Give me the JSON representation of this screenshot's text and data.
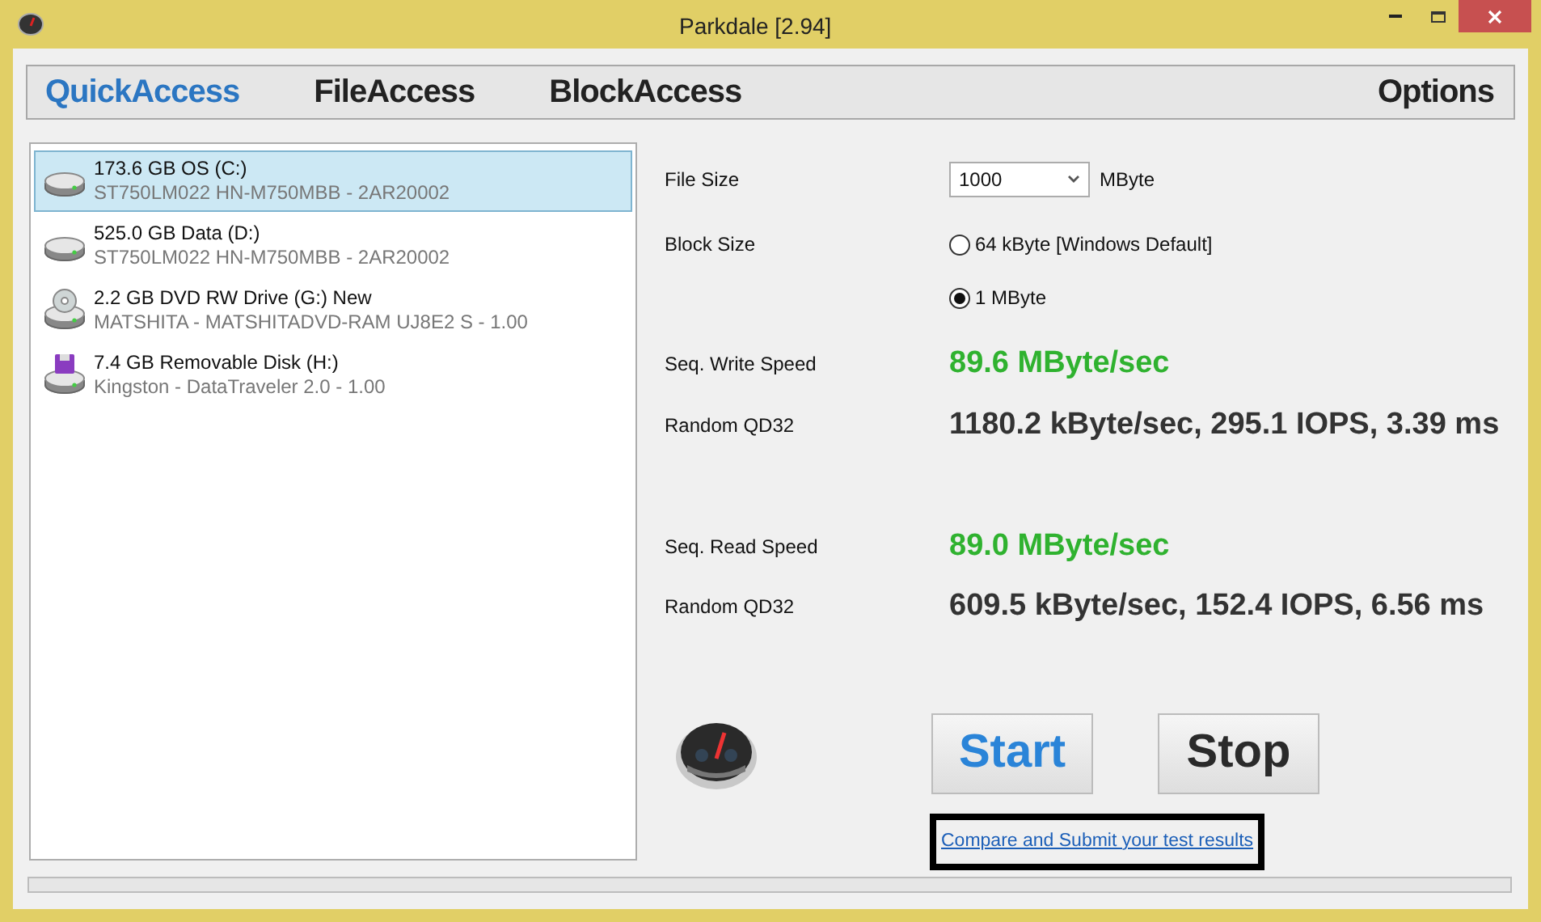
{
  "window": {
    "title": "Parkdale [2.94]"
  },
  "tabs": [
    {
      "label": "QuickAccess",
      "selected": true
    },
    {
      "label": "FileAccess",
      "selected": false
    },
    {
      "label": "BlockAccess",
      "selected": false
    },
    {
      "label": "Options",
      "selected": false
    }
  ],
  "drives": [
    {
      "kind": "hdd",
      "name": "173.6 GB OS (C:)",
      "detail": "ST750LM022 HN-M750MBB - 2AR20002",
      "selected": true
    },
    {
      "kind": "hdd",
      "name": "525.0 GB Data (D:)",
      "detail": "ST750LM022 HN-M750MBB - 2AR20002",
      "selected": false
    },
    {
      "kind": "dvd",
      "name": "2.2 GB DVD RW Drive (G:) New",
      "detail": "MATSHITA - MATSHITADVD-RAM UJ8E2 S - 1.00",
      "selected": false
    },
    {
      "kind": "usb",
      "name": "7.4 GB Removable Disk (H:)",
      "detail": "Kingston - DataTraveler 2.0 - 1.00",
      "selected": false
    }
  ],
  "file_size": {
    "label": "File Size",
    "value": "1000",
    "unit": "MByte"
  },
  "block_size": {
    "label": "Block Size",
    "options": [
      {
        "label": "64 kByte [Windows Default]",
        "selected": false
      },
      {
        "label": "1 MByte",
        "selected": true
      }
    ]
  },
  "results": [
    {
      "kind": "seq",
      "label": "Seq. Write Speed",
      "value": "89.6 MByte/sec"
    },
    {
      "kind": "random",
      "label": "Random QD32",
      "value": "1180.2 kByte/sec, 295.1 IOPS, 3.39 ms"
    },
    {
      "kind": "seq",
      "label": "Seq. Read Speed",
      "value": "89.0 MByte/sec"
    },
    {
      "kind": "random",
      "label": "Random QD32",
      "value": "609.5 kByte/sec, 152.4 IOPS, 6.56 ms"
    }
  ],
  "buttons": [
    {
      "kind": "start",
      "label": "Start"
    },
    {
      "kind": "stop",
      "label": "Stop"
    }
  ],
  "link": "Compare and Submit your test results",
  "progress": {
    "level": 0
  }
}
